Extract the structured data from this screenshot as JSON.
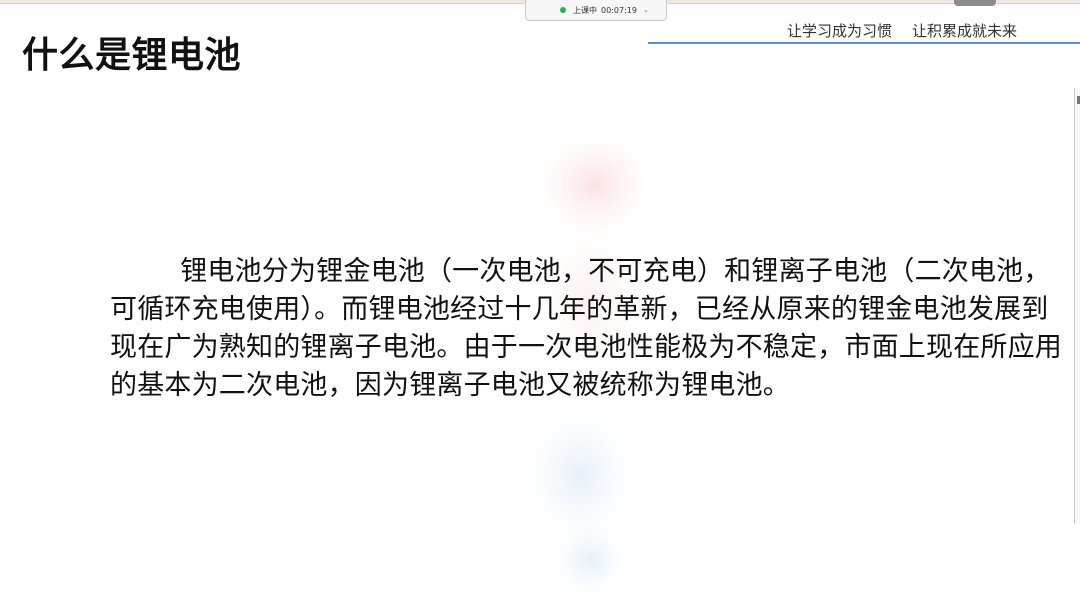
{
  "status_bar": {
    "label": "上课中",
    "timer": "00:07:19",
    "dropdown_glyph": "⌄",
    "indicator_color": "#27b14a"
  },
  "header": {
    "slogan_left": "让学习成为习惯",
    "slogan_right": "让积累成就未来",
    "rule_color": "#5f90c8"
  },
  "slide": {
    "title": "什么是锂电池",
    "body": "锂电池分为锂金电池（一次电池，不可充电）和锂离子电池（二次电池，可循环充电使用）。而锂电池经过十几年的革新，已经从原来的锂金电池发展到现在广为熟知的锂离子电池。由于一次电池性能极为不稳定，市面上现在所应用的基本为二次电池，因为锂离子电池又被统称为锂电池。"
  }
}
